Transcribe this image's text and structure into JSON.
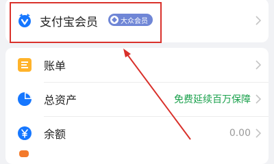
{
  "member": {
    "label": "支付宝会员",
    "badge": "大众会员",
    "icon": "alipay-member-icon"
  },
  "rows": [
    {
      "label": "账单",
      "icon": "bill-icon",
      "right_text": ""
    },
    {
      "label": "总资产",
      "icon": "assets-pie-icon",
      "right_text": "免费延续百万保障"
    },
    {
      "label": "余额",
      "icon": "balance-yen-icon",
      "right_text": "0.00"
    }
  ],
  "colors": {
    "accent_blue": "#1677ff",
    "bill_orange": "#ffb32a",
    "promo_green": "#19a04b",
    "annotation_red": "#d9302a",
    "badge_blue": "#6f86d6"
  }
}
